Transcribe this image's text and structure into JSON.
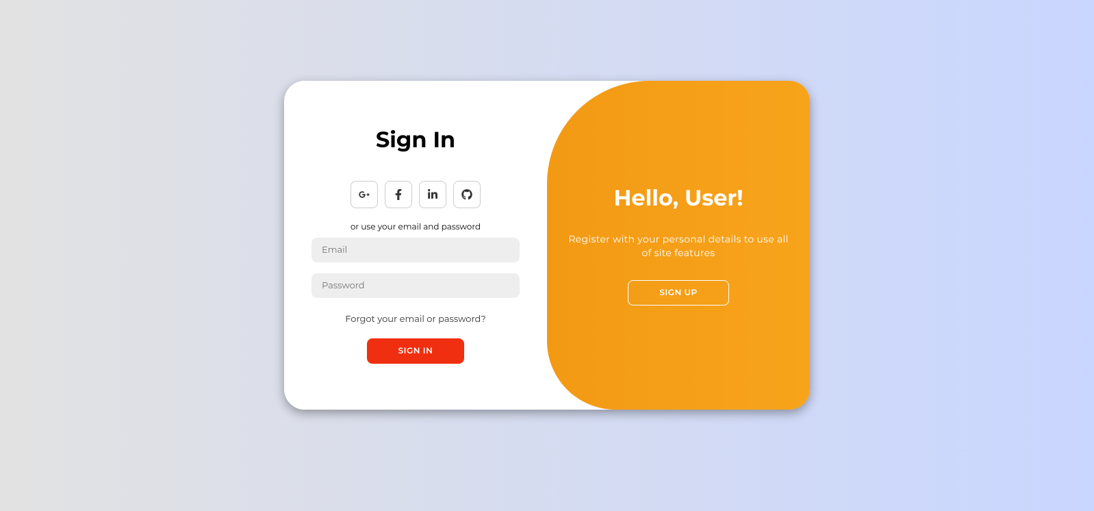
{
  "signIn": {
    "title": "Sign In",
    "socialText": "or use your email and password",
    "emailPlaceholder": "Email",
    "passwordPlaceholder": "Password",
    "forgotText": "Forgot your email or password?",
    "buttonText": "Sign In"
  },
  "togglePanel": {
    "title": "Hello, User!",
    "description": "Register with your personal details to use all of site features",
    "buttonText": "Sign Up"
  },
  "icons": {
    "googlePlus": "google-plus-icon",
    "facebook": "facebook-icon",
    "linkedin": "linkedin-icon",
    "github": "github-icon"
  }
}
